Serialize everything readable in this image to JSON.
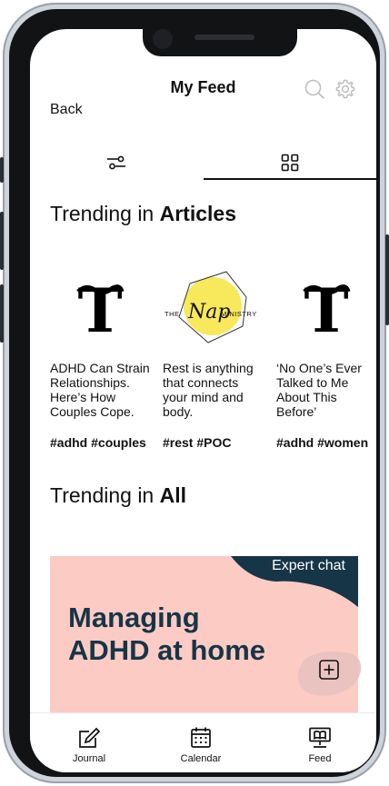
{
  "header": {
    "title": "My Feed",
    "back_label": "Back",
    "icons": [
      "search-icon",
      "gear-icon"
    ]
  },
  "tabs": {
    "icons": [
      "sliders-icon",
      "grid-icon"
    ],
    "active": "grid-icon"
  },
  "sections": {
    "articles": {
      "prefix": "Trending in ",
      "emphasis": "Articles"
    },
    "all": {
      "prefix": "Trending in ",
      "emphasis": "All"
    }
  },
  "articles": [
    {
      "source_icon": "nyt-logo-icon",
      "description": "ADHD Can Strain Relationships. Here’s How Couples Cope.",
      "tags": "#adhd #couples"
    },
    {
      "source_icon": "nap-ministry-logo",
      "logo_text_left": "THE",
      "logo_text_script": "Nap",
      "logo_text_right": "MINISTRY",
      "description": "Rest is anything that connects your mind and body.",
      "tags": "#rest #POC"
    },
    {
      "source_icon": "nyt-logo-icon",
      "description": "‘No One’s Ever Talked to Me About This Before’",
      "tags": "#adhd #women"
    }
  ],
  "banner": {
    "tag": "Expert chat",
    "headline_line1": "Managing",
    "headline_line2": "ADHD at home",
    "colors": {
      "background": "#fbcbc4",
      "accent": "#163547"
    }
  },
  "fab": {
    "icon": "add-icon"
  },
  "bottom_nav": [
    {
      "label": "Journal",
      "icon": "journal-icon"
    },
    {
      "label": "Calendar",
      "icon": "calendar-icon"
    },
    {
      "label": "Feed",
      "icon": "feed-icon"
    }
  ]
}
